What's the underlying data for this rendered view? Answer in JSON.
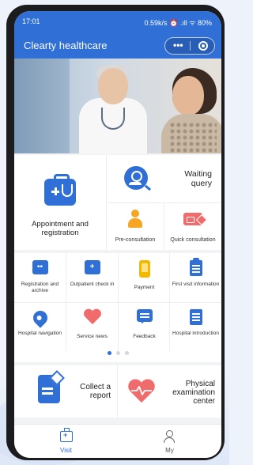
{
  "status_bar": {
    "time": "17:01",
    "right": "0.59k/s ⏰ .ıll ᯤ 80%"
  },
  "app": {
    "title": "Clearty healthcare",
    "capsule_more": "•••"
  },
  "colors": {
    "primary": "#2f6fd6",
    "accent_red": "#f06b6b",
    "accent_yellow": "#f5a623"
  },
  "main_services": {
    "appointment": "Appointment and registration",
    "waiting_query": "Waiting query",
    "pre_consultation": "Pre-consultation",
    "quick_consultation": "Quick consultation"
  },
  "services_grid": [
    {
      "label": "Registration and archive",
      "icon": "id-card-icon"
    },
    {
      "label": "Outpatient check in",
      "icon": "plus-calendar-icon"
    },
    {
      "label": "Payment",
      "icon": "phone-icon"
    },
    {
      "label": "First visit information",
      "icon": "clipboard-icon"
    },
    {
      "label": "Hospital navigation",
      "icon": "location-pin-icon"
    },
    {
      "label": "Service news",
      "icon": "heart-icon"
    },
    {
      "label": "Feedback",
      "icon": "chat-bubble-icon"
    },
    {
      "label": "Hospital introduction",
      "icon": "document-icon"
    }
  ],
  "bottom_cards": {
    "collect_report": "Collect a report",
    "physical_exam": "Physical examination center"
  },
  "tabbar": {
    "visit": "Visit",
    "my": "My"
  }
}
